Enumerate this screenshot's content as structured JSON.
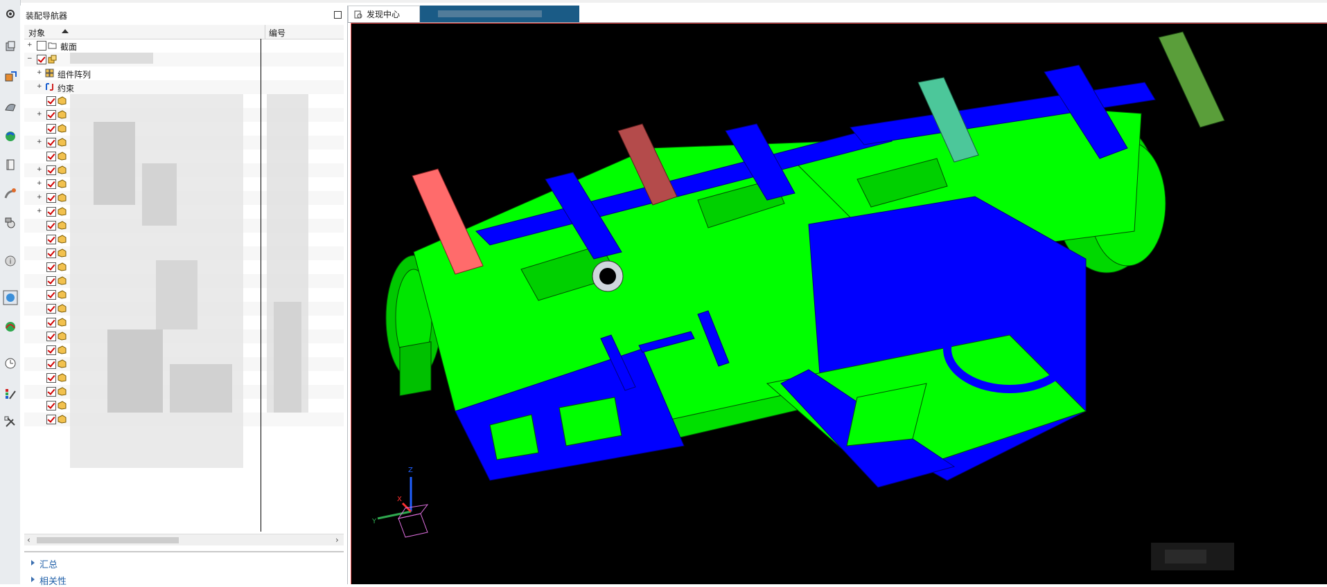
{
  "navigator": {
    "title": "装配导航器",
    "columns": {
      "object": "对象",
      "number": "编号"
    },
    "rows": [
      {
        "label": "截面",
        "kind": "folder"
      },
      {
        "label": "",
        "kind": "assembly"
      },
      {
        "label": "组件阵列",
        "kind": "array"
      },
      {
        "label": "约束",
        "kind": "constraint"
      }
    ]
  },
  "sections": [
    {
      "label": "汇总"
    },
    {
      "label": "相关性"
    }
  ],
  "tabs": [
    {
      "label": "发现中心"
    },
    {
      "label": ""
    }
  ],
  "triad": {
    "x": "X",
    "y": "Y",
    "z": "Z"
  },
  "colors": {
    "blue": "#0000ff",
    "green": "#00ff00",
    "salmon": "#ff6b6b",
    "brown": "#b44b4b",
    "teal": "#4cc79a",
    "olive": "#5a9e3a"
  },
  "icons": [
    "settings-icon",
    "assembly-navigator-icon",
    "constraint-navigator-icon",
    "part-navigator-icon",
    "reuse-library-icon",
    "hd3d-icon",
    "web-browser-icon",
    "history-icon",
    "system-materials-icon",
    "process-studio-icon",
    "roles-icon",
    "system-scenes-icon",
    "timeline-icon",
    "palette-icon",
    "tools-icon"
  ]
}
